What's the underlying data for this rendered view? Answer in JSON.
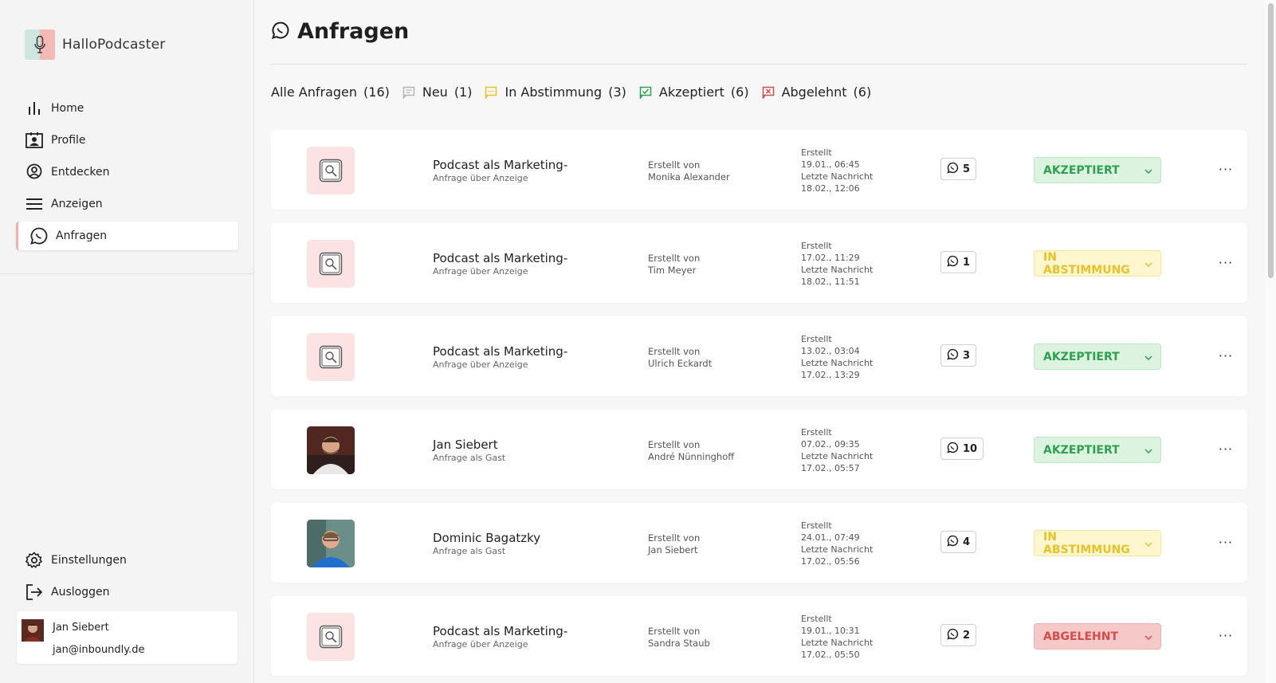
{
  "app": {
    "name": "HalloPodcaster"
  },
  "sidebar": {
    "items": [
      {
        "label": "Home",
        "icon": "bar-chart-icon"
      },
      {
        "label": "Profile",
        "icon": "profile-card-icon"
      },
      {
        "label": "Entdecken",
        "icon": "location-pin-icon"
      },
      {
        "label": "Anzeigen",
        "icon": "menu-lines-icon"
      },
      {
        "label": "Anfragen",
        "icon": "chat-bubble-icon",
        "active": true
      }
    ],
    "bottom_items": [
      {
        "label": "Einstellungen",
        "icon": "gear-icon"
      },
      {
        "label": "Ausloggen",
        "icon": "logout-icon"
      }
    ],
    "user": {
      "name": "Jan Siebert",
      "email": "jan@inboundly.de"
    }
  },
  "page": {
    "title": "Anfragen"
  },
  "filters": [
    {
      "label": "Alle Anfragen",
      "count": "(16)",
      "icon": ""
    },
    {
      "label": "Neu",
      "count": "(1)",
      "icon": "flag-grey-icon"
    },
    {
      "label": "In Abstimmung",
      "count": "(3)",
      "icon": "flag-yellow-icon"
    },
    {
      "label": "Akzeptiert",
      "count": "(6)",
      "icon": "flag-green-icon"
    },
    {
      "label": "Abgelehnt",
      "count": "(6)",
      "icon": "flag-red-icon"
    }
  ],
  "labels": {
    "created_by": "Erstellt von",
    "created": "Erstellt",
    "last_message": "Letzte Nachricht"
  },
  "requests": [
    {
      "title": "Podcast als Marketing-",
      "subtitle": "Anfrage über Anzeige",
      "creator": "Monika Alexander",
      "created": "19.01., 06:45",
      "last_message": "18.02., 12:06",
      "messages": "5",
      "status": "AKZEPTIERT",
      "status_type": "accepted",
      "thumb": "placeholder"
    },
    {
      "title": "Podcast als Marketing-",
      "subtitle": "Anfrage über Anzeige",
      "creator": "Tim Meyer",
      "created": "17.02., 11:29",
      "last_message": "18.02., 11:51",
      "messages": "1",
      "status": "IN ABSTIMMUNG",
      "status_type": "pending",
      "thumb": "placeholder"
    },
    {
      "title": "Podcast als Marketing-",
      "subtitle": "Anfrage über Anzeige",
      "creator": "Ulrich Eckardt",
      "created": "13.02., 03:04",
      "last_message": "17.02., 13:29",
      "messages": "3",
      "status": "AKZEPTIERT",
      "status_type": "accepted",
      "thumb": "placeholder"
    },
    {
      "title": "Jan Siebert",
      "subtitle": "Anfrage als Gast",
      "creator": "André Nünninghoff",
      "created": "07.02., 09:35",
      "last_message": "17.02., 05:57",
      "messages": "10",
      "status": "AKZEPTIERT",
      "status_type": "accepted",
      "thumb": "photo-dark"
    },
    {
      "title": "Dominic Bagatzky",
      "subtitle": "Anfrage als Gast",
      "creator": "Jan Siebert",
      "created": "24.01., 07:49",
      "last_message": "17.02., 05:56",
      "messages": "4",
      "status": "IN ABSTIMMUNG",
      "status_type": "pending",
      "thumb": "photo-blue"
    },
    {
      "title": "Podcast als Marketing-",
      "subtitle": "Anfrage über Anzeige",
      "creator": "Sandra Staub",
      "created": "19.01., 10:31",
      "last_message": "17.02., 05:50",
      "messages": "2",
      "status": "ABGELEHNT",
      "status_type": "rejected",
      "thumb": "placeholder"
    }
  ],
  "colors": {
    "accepted": "#2fa051",
    "pending": "#e8c22a",
    "rejected": "#d54c4c",
    "accent_pink": "#f2b2ac"
  }
}
